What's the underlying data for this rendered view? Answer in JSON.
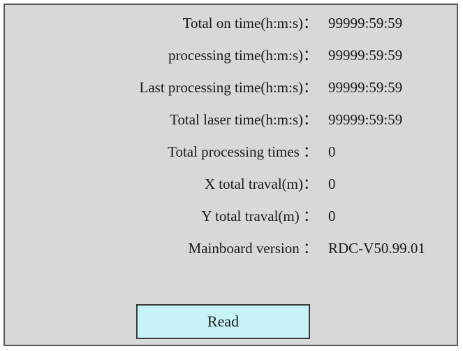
{
  "info": {
    "rows": [
      {
        "label": "Total on time(h:m:s)：",
        "value": "99999:59:59"
      },
      {
        "label": "processing time(h:m:s)：",
        "value": "99999:59:59"
      },
      {
        "label": "Last processing time(h:m:s)：",
        "value": "99999:59:59"
      },
      {
        "label": "Total laser time(h:m:s)：",
        "value": "99999:59:59"
      },
      {
        "label": "Total processing times ：",
        "value": "0"
      },
      {
        "label": "X total traval(m)：",
        "value": "0"
      },
      {
        "label": "Y total traval(m) ：",
        "value": "0"
      },
      {
        "label": "Mainboard version ：",
        "value": "RDC-V50.99.01"
      }
    ]
  },
  "actions": {
    "read_label": "Read"
  },
  "colors": {
    "panel_background": "#d8d8d8",
    "button_background": "#c6f3f7",
    "border": "#3a3a3a"
  }
}
